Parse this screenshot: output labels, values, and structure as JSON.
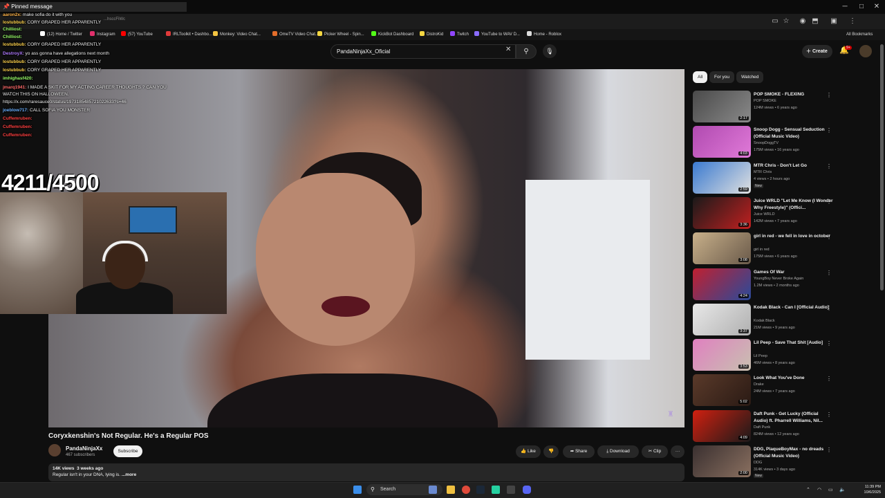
{
  "browser": {
    "partial_url": "...hsccFiWc",
    "bookmarks": [
      {
        "label": "(12) Home / Twitter",
        "color": "#ffffff"
      },
      {
        "label": "Instagram",
        "color": "#e1306c"
      },
      {
        "label": "(57) YouTube",
        "color": "#ff0000"
      },
      {
        "label": "IRLToolkit • Dashbo...",
        "color": "#e03a3a"
      },
      {
        "label": "Monkey: Video Chat...",
        "color": "#f5c542"
      },
      {
        "label": "OmeTV Video Chat...",
        "color": "#e36d2a"
      },
      {
        "label": "Picker Wheel - Spin...",
        "color": "#f5d742"
      },
      {
        "label": "KickBot Dashboard",
        "color": "#53fc18"
      },
      {
        "label": "DistroKid",
        "color": "#f5d742"
      },
      {
        "label": "Twitch",
        "color": "#9146ff"
      },
      {
        "label": "YouTube to WAV D...",
        "color": "#8a6cff"
      },
      {
        "label": "Home - Roblox",
        "color": "#dddddd"
      }
    ],
    "all_bookmarks": "All Bookmarks"
  },
  "youtube": {
    "search_value": "PandaNinjaXx_Oficial",
    "create_label": "Create",
    "notifications_badge": "9+",
    "chips": [
      "All",
      "For you",
      "Watched"
    ],
    "video": {
      "title": "Coryxkenshin's Not Regular. He's a Regular POS",
      "channel": "PandaNinjaXx",
      "subscribers": "467 subscribers",
      "subscribe_label": "Subscribe",
      "like_label": "Like",
      "share_label": "Share",
      "download_label": "Download",
      "clip_label": "Clip",
      "more_label": "···",
      "views": "14K views",
      "age": "3 weeks ago",
      "description": "Regular isn't in your DNA, lying is.",
      "description_more": "...more"
    },
    "recommendations": [
      {
        "title": "POP SMOKE - FLEXING",
        "channel": "POP SMOKE",
        "meta": "124M views • 6 years ago",
        "duration": "2:17",
        "badge": "",
        "c1": "#4a4a4a",
        "c2": "#8a8a8a"
      },
      {
        "title": "Snoop Dogg - Sensual Seduction (Official Music Video)",
        "channel": "SnoopDoggTV",
        "meta": "175M views • 16 years ago",
        "duration": "4:03",
        "badge": "",
        "c1": "#b04ab0",
        "c2": "#e07ad8"
      },
      {
        "title": "MTR Chris - Don't Let Go",
        "channel": "MTR Chris",
        "meta": "4 views • 2 hours ago",
        "duration": "2:59",
        "badge": "New",
        "c1": "#3a7ad0",
        "c2": "#e0e0e0"
      },
      {
        "title": "Juice WRLD \"Let Me Know (I Wonder Why Freestyle)\" (Offici...",
        "channel": "Juice WRLD",
        "meta": "142M views • 7 years ago",
        "duration": "3:36",
        "badge": "",
        "c1": "#1a1a1a",
        "c2": "#c02020"
      },
      {
        "title": "girl in red - we fell in love in october",
        "channel": "girl in red",
        "meta": "175M views • 6 years ago",
        "duration": "3:08",
        "badge": "",
        "c1": "#c8b08a",
        "c2": "#6a5a4a"
      },
      {
        "title": "Games Of War",
        "channel": "YoungBoy Never Broke Again",
        "meta": "1.2M views • 2 months ago",
        "duration": "4:24",
        "badge": "",
        "c1": "#c02030",
        "c2": "#2a4a9a"
      },
      {
        "title": "Kodak Black - Can I [Official Audio]",
        "channel": "Kodak Black",
        "meta": "21M views • 9 years ago",
        "duration": "3:37",
        "badge": "",
        "c1": "#e8e8e8",
        "c2": "#b0b0b0"
      },
      {
        "title": "Lil Peep - Save That Shit [Audio]",
        "channel": "Lil Peep",
        "meta": "46M views • 8 years ago",
        "duration": "3:53",
        "badge": "",
        "c1": "#e080c0",
        "c2": "#c8c0b0"
      },
      {
        "title": "Look What You've Done",
        "channel": "Drake",
        "meta": "24M views • 7 years ago",
        "duration": "5:02",
        "badge": "",
        "c1": "#5a3a2a",
        "c2": "#2a1a14"
      },
      {
        "title": "Daft Punk - Get Lucky (Official Audio) ft. Pharrell Williams, Nil...",
        "channel": "Daft Punk",
        "meta": "824M views • 12 years ago",
        "duration": "4:09",
        "badge": "",
        "c1": "#d02010",
        "c2": "#1a1a1a"
      },
      {
        "title": "DDG, PlaqueBoyMax - no dreads (Official Music Video)",
        "channel": "DDG",
        "meta": "314K views • 3 days ago",
        "duration": "2:00",
        "badge": "New",
        "c1": "#3a3030",
        "c2": "#8a7060"
      }
    ]
  },
  "overlay": {
    "pinned_label": "Pinned message",
    "counter": "4211/4500",
    "chat": [
      {
        "user": "aaron2x:",
        "text": "make sofia do it with you",
        "color": "#ffb347"
      },
      {
        "user": "lostubbub:",
        "text": "CORY GRAPED HER APPARENTLY",
        "color": "#ffd34d"
      },
      {
        "user": "Chilliost:",
        "text": "",
        "color": "#9aff6a"
      },
      {
        "user": "Chilliost:",
        "text": "",
        "color": "#9aff6a"
      },
      {
        "user": "lostubbub:",
        "text": "CORY GRAPED HER APPARENTLY",
        "color": "#ffd34d"
      },
      {
        "user": "DestroyX:",
        "text": "yo ass gonna have allegations next month",
        "color": "#b07aff"
      },
      {
        "user": "lostubbub:",
        "text": "CORY GRAPED HER APPARENTLY",
        "color": "#ffd34d"
      },
      {
        "user": "lostubbub:",
        "text": "CORY GRAPED HER APPARENTLY",
        "color": "#ffd34d"
      },
      {
        "user": "imhighasf420:",
        "text": "",
        "color": "#9aff6a"
      },
      {
        "user": "jmarq1941:",
        "text": "I MADE A SKIT FOR MY ACTING CAREER THOUGHTS ? CAN YOU",
        "color": "#ff6a6a"
      },
      {
        "user": "",
        "text": "WATCH THIS ON HALLOWEEN.",
        "color": "#ffffff"
      },
      {
        "user": "",
        "text": "https://x.com/raresauce0/status/1973185485721022633?s=46",
        "color": "#ffffff"
      },
      {
        "user": "joeblow717:",
        "text": "CALL SOFIA YOU MONSTER",
        "color": "#6ab0ff"
      },
      {
        "user": "Cuffemruben:",
        "text": "",
        "color": "#ff4040"
      },
      {
        "user": "Cuffemruben:",
        "text": "",
        "color": "#ff4040"
      },
      {
        "user": "Cuffemruben:",
        "text": "",
        "color": "#ff4040"
      }
    ]
  },
  "taskbar": {
    "search_label": "Search",
    "time": "11:39 PM",
    "date": "10/6/2025"
  }
}
